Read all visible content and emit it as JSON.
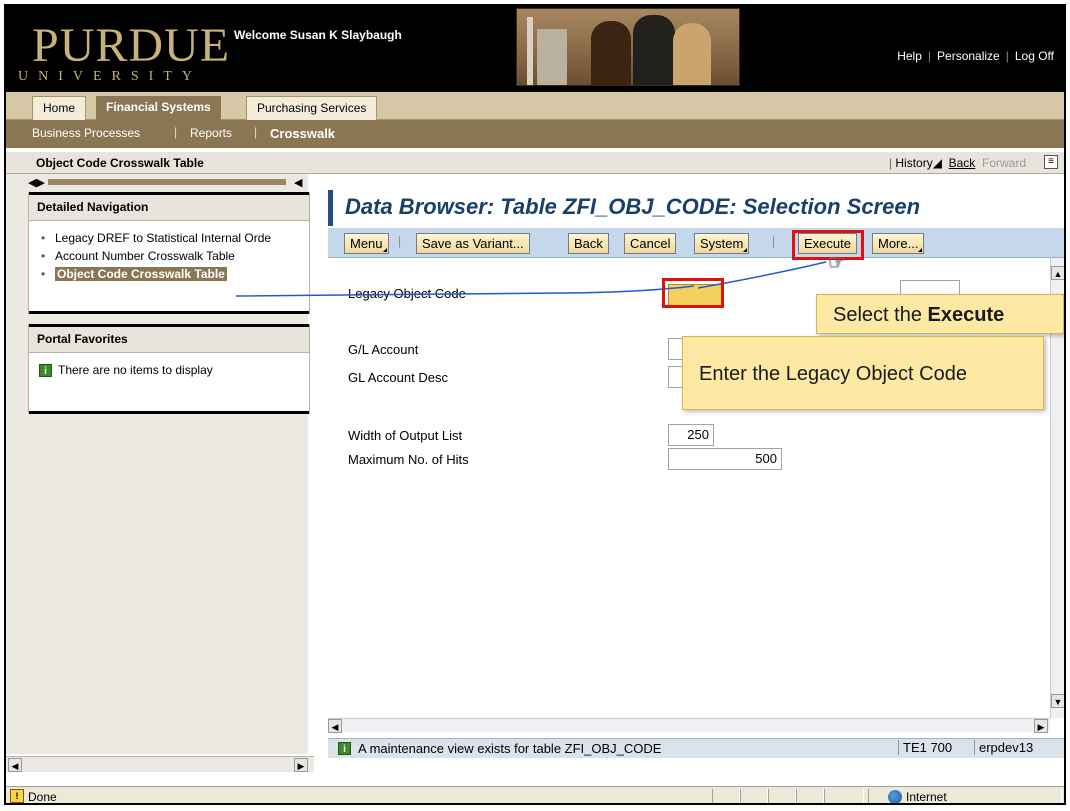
{
  "header": {
    "logo_word": "PURDUE",
    "logo_sub": "UNIVERSITY",
    "welcome": "Welcome Susan K Slaybaugh",
    "links": [
      "Help",
      "Personalize",
      "Log Off"
    ]
  },
  "tabs": {
    "level1": [
      "Home",
      "Financial Systems",
      "Purchasing Services"
    ],
    "level2": [
      "Business Processes",
      "Reports",
      "Crosswalk"
    ],
    "active_level1": "Financial Systems",
    "active_level2": "Crosswalk"
  },
  "titlebar": {
    "title": "Object Code Crosswalk Table",
    "history": "History",
    "back": "Back",
    "forward": "Forward"
  },
  "nav": {
    "detailed_title": "Detailed Navigation",
    "items": [
      "Legacy DREF to Statistical Internal Orde",
      "Account Number Crosswalk Table",
      "Object Code Crosswalk Table"
    ],
    "active_index": 2,
    "favorites_title": "Portal Favorites",
    "favorites_empty": "There are no items to display"
  },
  "main": {
    "title": "Data Browser: Table ZFI_OBJ_CODE: Selection Screen",
    "toolbar": [
      "Menu",
      "Save as Variant...",
      "Back",
      "Cancel",
      "System",
      "Execute",
      "More..."
    ],
    "fields": {
      "legacy_object_code": "Legacy Object Code",
      "gl_account": "G/L Account",
      "gl_account_desc": "GL Account Desc",
      "width_output": "Width of Output List",
      "width_output_value": "250",
      "max_hits": "Maximum No. of Hits",
      "max_hits_value": "500"
    },
    "status": {
      "message": "A maintenance view exists for table ZFI_OBJ_CODE",
      "system": "TE1 700",
      "host": "erpdev13"
    }
  },
  "callouts": {
    "execute": "Select the",
    "execute_bold": "Execute",
    "legacy": "Enter the Legacy Object Code"
  },
  "browser_status": {
    "done": "Done",
    "zone": "Internet"
  },
  "colors": {
    "accent_gold": "#8b7653",
    "header_black": "#000000",
    "title_blue": "#1a3f68",
    "callout_yellow": "#fde8a4",
    "highlight_red": "#e01010"
  }
}
